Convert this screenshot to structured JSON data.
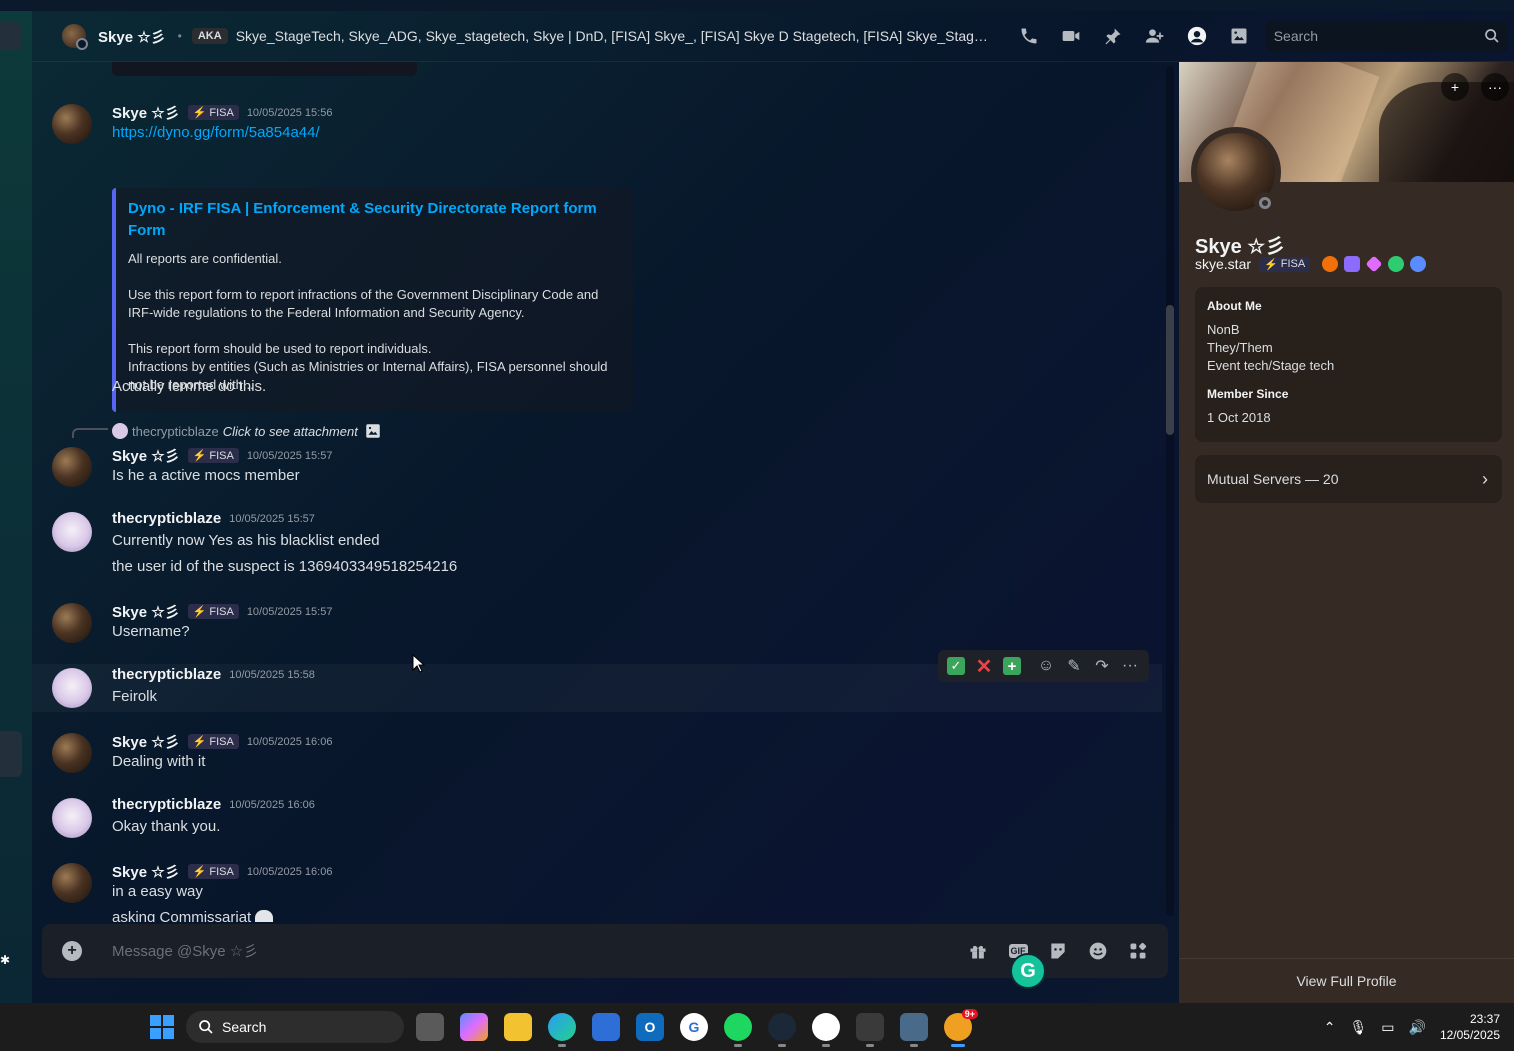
{
  "header": {
    "title": "Skye ☆彡",
    "aka_label": "AKA",
    "aka_list": "Skye_StageTech, Skye_ADG, Skye_stagetech, Skye | DnD, [FISA] Skye_, [FISA] Skye D Stagetech, [FISA] Skye_StageTech, S...",
    "search_placeholder": "Search"
  },
  "messages": [
    {
      "author": "Skye ☆彡",
      "tag": "FISA",
      "timestamp": "10/05/2025 15:56",
      "link": "https://dyno.gg/form/5a854a44/",
      "embed": {
        "title": "Dyno - IRF FISA | Enforcement & Security Directorate Report form Form",
        "p1": "All reports are confidential.",
        "p2": "Use this report form to report infractions of the Government Disciplinary Code and\nIRF-wide regulations to the Federal Information and Security Agency.",
        "p3": "This report form should be used to report individuals.\nInfractions by entities (Such as Ministries or Internal Affairs), FISA personnel should\nnot be reported with..."
      },
      "text": "Actually lemme do this."
    },
    {
      "reply": {
        "author": "thecrypticblaze",
        "text": "Click to see attachment"
      },
      "author": "Skye ☆彡",
      "tag": "FISA",
      "timestamp": "10/05/2025 15:57",
      "text": "Is he a active mocs member"
    },
    {
      "author": "thecrypticblaze",
      "timestamp": "10/05/2025 15:57",
      "text": "Currently now Yes as his blacklist ended",
      "text2": "the user id of the suspect is 1369403349518254216"
    },
    {
      "author": "Skye ☆彡",
      "tag": "FISA",
      "timestamp": "10/05/2025 15:57",
      "text": "Username?"
    },
    {
      "author": "thecrypticblaze",
      "timestamp": "10/05/2025 15:58",
      "text": "Feirolk"
    },
    {
      "author": "Skye ☆彡",
      "tag": "FISA",
      "timestamp": "10/05/2025 16:06",
      "text": "Dealing with it"
    },
    {
      "author": "thecrypticblaze",
      "timestamp": "10/05/2025 16:06",
      "text": "Okay thank you."
    },
    {
      "author": "Skye ☆彡",
      "tag": "FISA",
      "timestamp": "10/05/2025 16:06",
      "text": "in a easy way",
      "text2": "asking Commissariat"
    }
  ],
  "composer": {
    "placeholder": "Message @Skye ☆彡"
  },
  "profile": {
    "display_name": "Skye ☆彡",
    "username": "skye.star",
    "tag": "FISA",
    "about_label": "About Me",
    "about_lines": [
      "NonB",
      "They/Them",
      "Event tech/Stage tech"
    ],
    "member_since_label": "Member Since",
    "member_since": "1 Oct 2018",
    "mutual_servers": "Mutual Servers — 20",
    "view_full": "View Full Profile",
    "badge_colors": [
      "#f0700a",
      "#8a6cff",
      "#e06cff",
      "#2ecc71",
      "#5b8cff"
    ]
  },
  "taskbar": {
    "search": "Search",
    "time": "23:37",
    "date": "12/05/2025",
    "discord_badge": "9+"
  },
  "colors": {
    "accent": "#5865f2",
    "link": "#00a8fc",
    "panel": "#352b24"
  }
}
